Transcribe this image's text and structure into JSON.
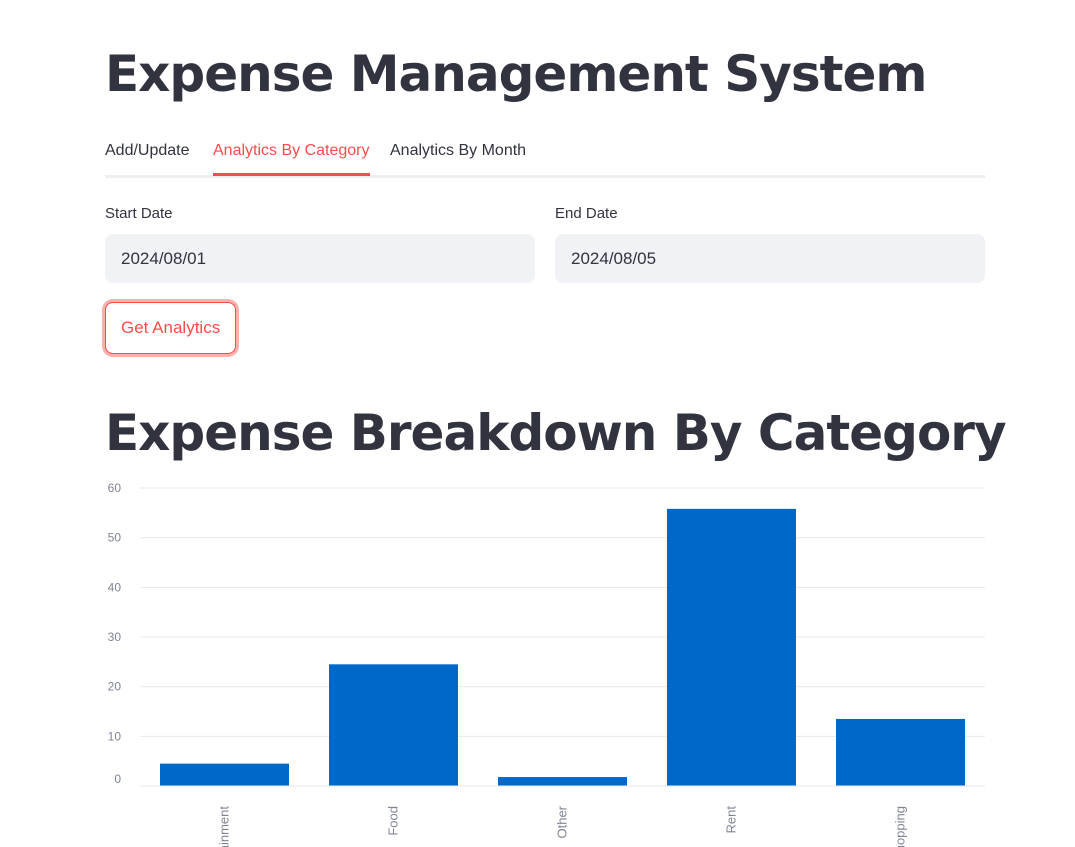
{
  "page": {
    "title": "Expense Management System"
  },
  "tabs": [
    {
      "label": "Add/Update",
      "active": false
    },
    {
      "label": "Analytics By Category",
      "active": true
    },
    {
      "label": "Analytics By Month",
      "active": false
    }
  ],
  "form": {
    "start_label": "Start Date",
    "start_value": "2024/08/01",
    "end_label": "End Date",
    "end_value": "2024/08/05",
    "button_label": "Get Analytics"
  },
  "section": {
    "title": "Expense Breakdown By Category"
  },
  "colors": {
    "accent": "#ff4b4b",
    "bar": "#0068c9",
    "grid": "#e6e9ef"
  },
  "chart_data": {
    "type": "bar",
    "categories": [
      "Entertainment",
      "Food",
      "Other",
      "Rent",
      "Shopping"
    ],
    "values": [
      4.5,
      24.5,
      1.8,
      55.8,
      13.5
    ],
    "title": "",
    "xlabel": "",
    "ylabel": "",
    "ylim": [
      0,
      60
    ],
    "yticks": [
      0,
      10,
      20,
      30,
      40,
      50,
      60
    ],
    "grid": true,
    "legend": "none"
  }
}
